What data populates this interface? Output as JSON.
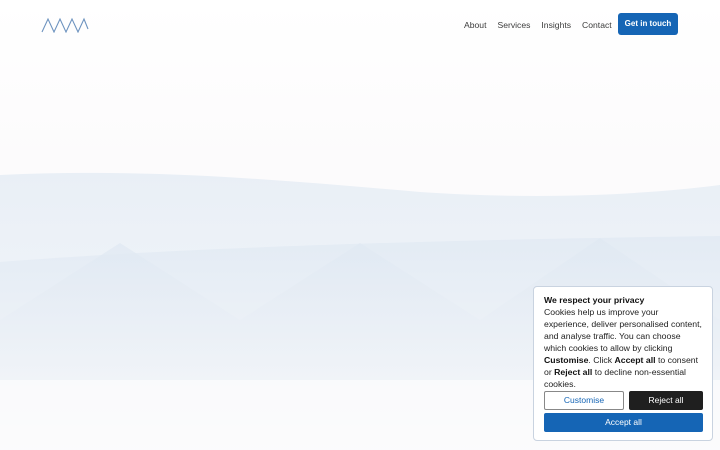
{
  "header": {
    "logo_icon": "wave-logo",
    "nav": [
      {
        "label": "About"
      },
      {
        "label": "Services"
      },
      {
        "label": "Insights"
      },
      {
        "label": "Contact"
      }
    ],
    "cta_label": "Get in touch"
  },
  "cookie_banner": {
    "title": "We respect your privacy",
    "text_1": "Cookies help us improve your experience, deliver personalised content, and analyse traffic. You can choose which cookies to allow by clicking ",
    "customise_word": "Customise",
    "text_2": ". Click ",
    "accept_word": "Accept all",
    "text_3": " to consent or ",
    "reject_word": "Reject all",
    "text_4": " to decline non-essential cookies.",
    "customise_label": "Customise",
    "reject_label": "Reject all",
    "accept_label": "Accept all"
  },
  "colors": {
    "accent": "#1565b5",
    "dark_button": "#1f1f1f"
  }
}
